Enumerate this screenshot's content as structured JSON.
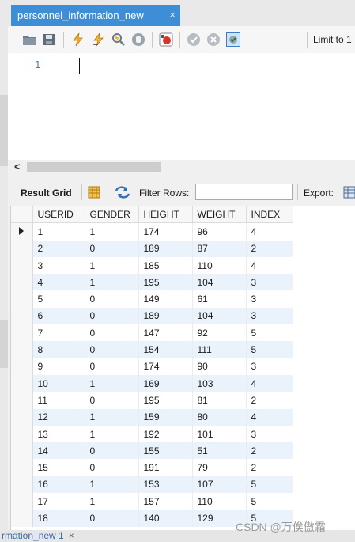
{
  "tab": {
    "title": "personnel_information_new",
    "close": "×"
  },
  "toolbar": {
    "icons": [
      "open-folder-icon",
      "save-icon",
      "execute-icon",
      "execute-current-icon",
      "explain-icon",
      "stop-icon",
      "toggle-error-icon",
      "commit-icon",
      "rollback-icon",
      "autocommit-icon"
    ],
    "limit_label": "Limit to 1"
  },
  "editor": {
    "line_number": "1"
  },
  "scroll": {
    "left_arrow": "<"
  },
  "result_bar": {
    "result_grid_label": "Result Grid",
    "filter_rows_label": "Filter Rows:",
    "filter_value": "",
    "export_label": "Export:"
  },
  "grid": {
    "columns": [
      "USERID",
      "GENDER",
      "HEIGHT",
      "WEIGHT",
      "INDEX"
    ],
    "rows": [
      [
        "1",
        "1",
        "174",
        "96",
        "4"
      ],
      [
        "2",
        "0",
        "189",
        "87",
        "2"
      ],
      [
        "3",
        "1",
        "185",
        "110",
        "4"
      ],
      [
        "4",
        "1",
        "195",
        "104",
        "3"
      ],
      [
        "5",
        "0",
        "149",
        "61",
        "3"
      ],
      [
        "6",
        "0",
        "189",
        "104",
        "3"
      ],
      [
        "7",
        "0",
        "147",
        "92",
        "5"
      ],
      [
        "8",
        "0",
        "154",
        "111",
        "5"
      ],
      [
        "9",
        "0",
        "174",
        "90",
        "3"
      ],
      [
        "10",
        "1",
        "169",
        "103",
        "4"
      ],
      [
        "11",
        "0",
        "195",
        "81",
        "2"
      ],
      [
        "12",
        "1",
        "159",
        "80",
        "4"
      ],
      [
        "13",
        "1",
        "192",
        "101",
        "3"
      ],
      [
        "14",
        "0",
        "155",
        "51",
        "2"
      ],
      [
        "15",
        "0",
        "191",
        "79",
        "2"
      ],
      [
        "16",
        "1",
        "153",
        "107",
        "5"
      ],
      [
        "17",
        "1",
        "157",
        "110",
        "5"
      ],
      [
        "18",
        "0",
        "140",
        "129",
        "5"
      ]
    ]
  },
  "bottom_tab": {
    "label": "rmation_new 1",
    "close": "×"
  },
  "watermark": "CSDN @万俟傲霜",
  "colors": {
    "tab_active": "#3d8ed6",
    "row_alt": "#eaf2fb"
  }
}
